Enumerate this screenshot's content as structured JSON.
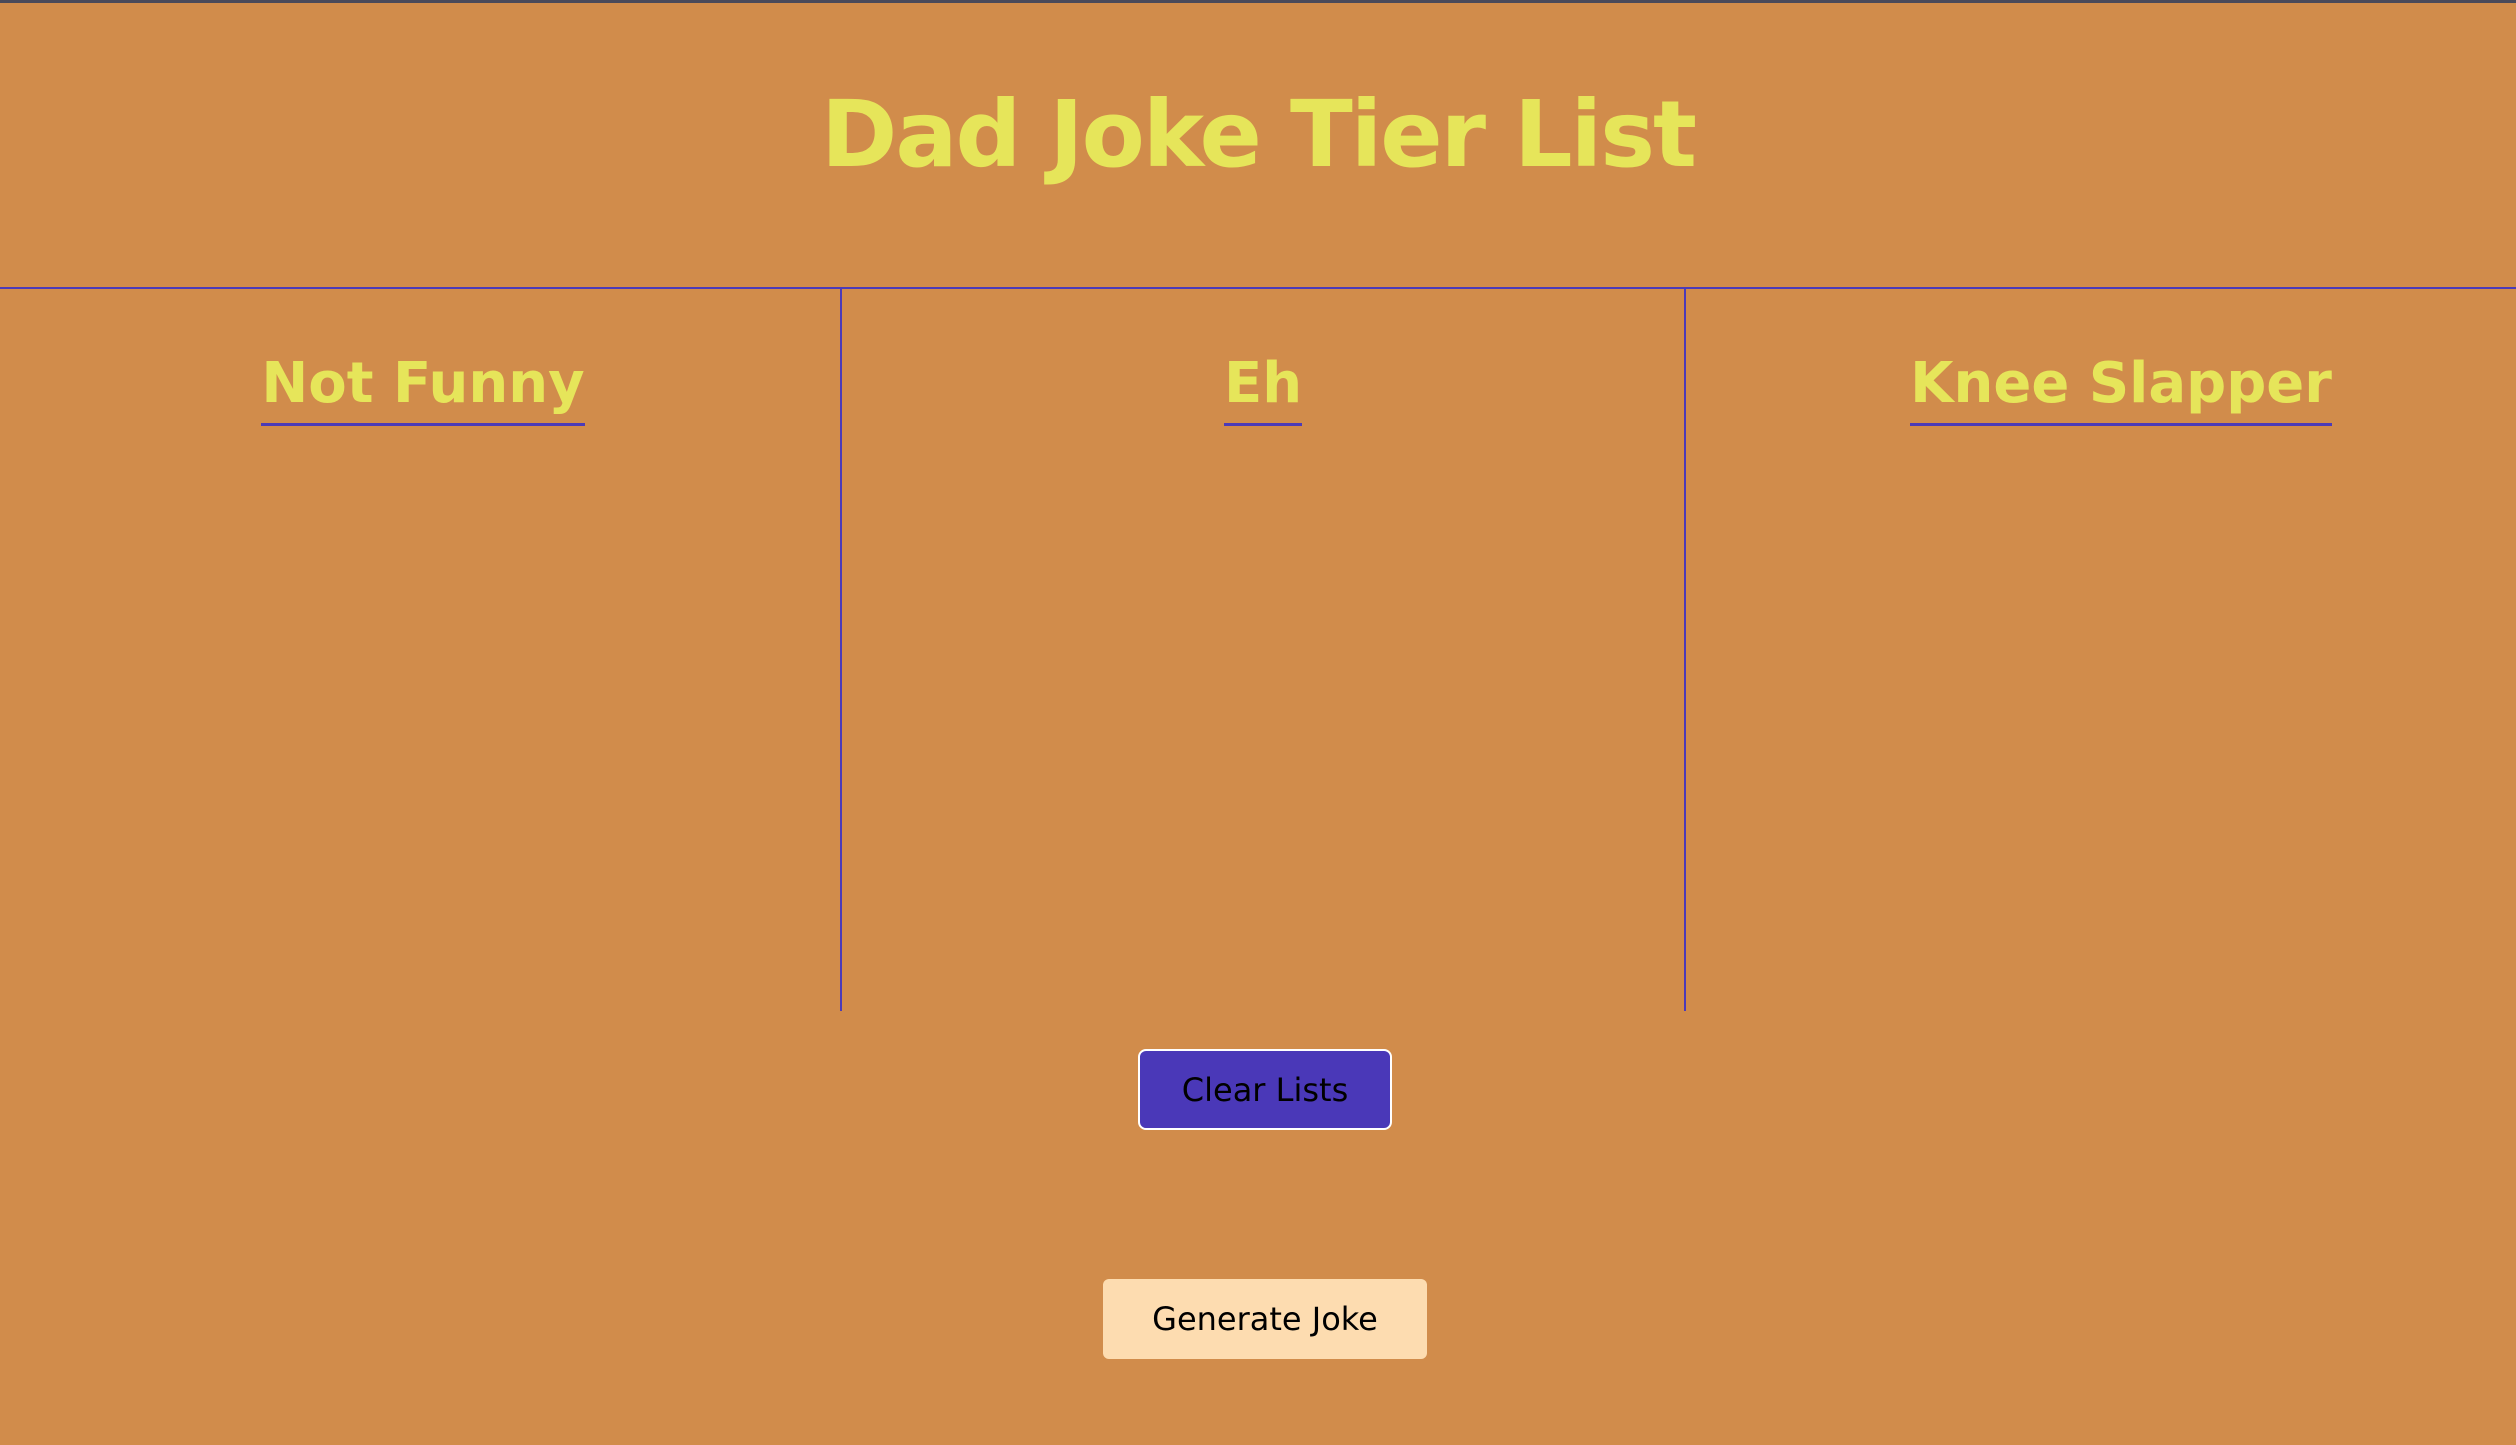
{
  "header": {
    "title": "Dad Joke Tier List"
  },
  "tiers": [
    {
      "label": "Not Funny",
      "jokes": []
    },
    {
      "label": "Eh",
      "jokes": []
    },
    {
      "label": "Knee Slapper",
      "jokes": []
    }
  ],
  "actions": {
    "clear_label": "Clear Lists",
    "generate_label": "Generate Joke"
  },
  "colors": {
    "background": "#D18C4B",
    "title": "#E6E55A",
    "accent": "#4B3BB8",
    "generate_button": "#FDDCB0"
  }
}
